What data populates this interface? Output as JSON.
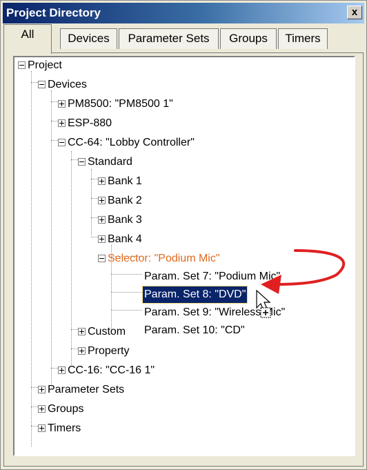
{
  "window": {
    "title": "Project Directory",
    "close_glyph": "x"
  },
  "tabs": [
    {
      "label": "All",
      "active": true
    },
    {
      "label": "Devices",
      "active": false
    },
    {
      "label": "Parameter Sets",
      "active": false
    },
    {
      "label": "Groups",
      "active": false
    },
    {
      "label": "Timers",
      "active": false
    }
  ],
  "tree": {
    "project": "Project",
    "devices": "Devices",
    "pm8500": "PM8500: \"PM8500 1\"",
    "esp880": "ESP-880",
    "cc64": "CC-64: \"Lobby Controller\"",
    "standard": "Standard",
    "bank1": "Bank 1",
    "bank2": "Bank 2",
    "bank3": "Bank 3",
    "bank4": "Bank 4",
    "selector": "Selector: \"Podium Mic\"",
    "pset7": "Param. Set 7: \"Podium Mic\"",
    "pset8": "Param. Set 8: \"DVD\"",
    "pset9": "Param. Set 9: \"Wireless Mic\"",
    "pset10": "Param. Set 10: \"CD\"",
    "custom": "Custom",
    "property": "Property",
    "cc16": "CC-16: \"CC-16 1\"",
    "parameter_sets": "Parameter Sets",
    "groups": "Groups",
    "timers": "Timers"
  },
  "selected_item": "Param. Set 8: \"DVD\"",
  "colors": {
    "selection": "#0a246a",
    "selector_text": "#e06a1e",
    "arrow": "#e02020"
  },
  "annotation": {
    "arrow": "from Param. Set 7 to Param. Set 8",
    "cursor": "drag-copy-cursor-icon"
  }
}
